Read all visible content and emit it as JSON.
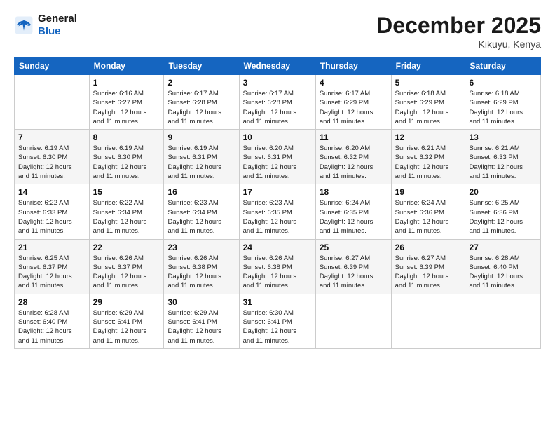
{
  "logo": {
    "line1": "General",
    "line2": "Blue"
  },
  "title": "December 2025",
  "location": "Kikuyu, Kenya",
  "header_days": [
    "Sunday",
    "Monday",
    "Tuesday",
    "Wednesday",
    "Thursday",
    "Friday",
    "Saturday"
  ],
  "weeks": [
    [
      {
        "day": "",
        "info": ""
      },
      {
        "day": "1",
        "info": "Sunrise: 6:16 AM\nSunset: 6:27 PM\nDaylight: 12 hours\nand 11 minutes."
      },
      {
        "day": "2",
        "info": "Sunrise: 6:17 AM\nSunset: 6:28 PM\nDaylight: 12 hours\nand 11 minutes."
      },
      {
        "day": "3",
        "info": "Sunrise: 6:17 AM\nSunset: 6:28 PM\nDaylight: 12 hours\nand 11 minutes."
      },
      {
        "day": "4",
        "info": "Sunrise: 6:17 AM\nSunset: 6:29 PM\nDaylight: 12 hours\nand 11 minutes."
      },
      {
        "day": "5",
        "info": "Sunrise: 6:18 AM\nSunset: 6:29 PM\nDaylight: 12 hours\nand 11 minutes."
      },
      {
        "day": "6",
        "info": "Sunrise: 6:18 AM\nSunset: 6:29 PM\nDaylight: 12 hours\nand 11 minutes."
      }
    ],
    [
      {
        "day": "7",
        "info": "Sunrise: 6:19 AM\nSunset: 6:30 PM\nDaylight: 12 hours\nand 11 minutes."
      },
      {
        "day": "8",
        "info": "Sunrise: 6:19 AM\nSunset: 6:30 PM\nDaylight: 12 hours\nand 11 minutes."
      },
      {
        "day": "9",
        "info": "Sunrise: 6:19 AM\nSunset: 6:31 PM\nDaylight: 12 hours\nand 11 minutes."
      },
      {
        "day": "10",
        "info": "Sunrise: 6:20 AM\nSunset: 6:31 PM\nDaylight: 12 hours\nand 11 minutes."
      },
      {
        "day": "11",
        "info": "Sunrise: 6:20 AM\nSunset: 6:32 PM\nDaylight: 12 hours\nand 11 minutes."
      },
      {
        "day": "12",
        "info": "Sunrise: 6:21 AM\nSunset: 6:32 PM\nDaylight: 12 hours\nand 11 minutes."
      },
      {
        "day": "13",
        "info": "Sunrise: 6:21 AM\nSunset: 6:33 PM\nDaylight: 12 hours\nand 11 minutes."
      }
    ],
    [
      {
        "day": "14",
        "info": "Sunrise: 6:22 AM\nSunset: 6:33 PM\nDaylight: 12 hours\nand 11 minutes."
      },
      {
        "day": "15",
        "info": "Sunrise: 6:22 AM\nSunset: 6:34 PM\nDaylight: 12 hours\nand 11 minutes."
      },
      {
        "day": "16",
        "info": "Sunrise: 6:23 AM\nSunset: 6:34 PM\nDaylight: 12 hours\nand 11 minutes."
      },
      {
        "day": "17",
        "info": "Sunrise: 6:23 AM\nSunset: 6:35 PM\nDaylight: 12 hours\nand 11 minutes."
      },
      {
        "day": "18",
        "info": "Sunrise: 6:24 AM\nSunset: 6:35 PM\nDaylight: 12 hours\nand 11 minutes."
      },
      {
        "day": "19",
        "info": "Sunrise: 6:24 AM\nSunset: 6:36 PM\nDaylight: 12 hours\nand 11 minutes."
      },
      {
        "day": "20",
        "info": "Sunrise: 6:25 AM\nSunset: 6:36 PM\nDaylight: 12 hours\nand 11 minutes."
      }
    ],
    [
      {
        "day": "21",
        "info": "Sunrise: 6:25 AM\nSunset: 6:37 PM\nDaylight: 12 hours\nand 11 minutes."
      },
      {
        "day": "22",
        "info": "Sunrise: 6:26 AM\nSunset: 6:37 PM\nDaylight: 12 hours\nand 11 minutes."
      },
      {
        "day": "23",
        "info": "Sunrise: 6:26 AM\nSunset: 6:38 PM\nDaylight: 12 hours\nand 11 minutes."
      },
      {
        "day": "24",
        "info": "Sunrise: 6:26 AM\nSunset: 6:38 PM\nDaylight: 12 hours\nand 11 minutes."
      },
      {
        "day": "25",
        "info": "Sunrise: 6:27 AM\nSunset: 6:39 PM\nDaylight: 12 hours\nand 11 minutes."
      },
      {
        "day": "26",
        "info": "Sunrise: 6:27 AM\nSunset: 6:39 PM\nDaylight: 12 hours\nand 11 minutes."
      },
      {
        "day": "27",
        "info": "Sunrise: 6:28 AM\nSunset: 6:40 PM\nDaylight: 12 hours\nand 11 minutes."
      }
    ],
    [
      {
        "day": "28",
        "info": "Sunrise: 6:28 AM\nSunset: 6:40 PM\nDaylight: 12 hours\nand 11 minutes."
      },
      {
        "day": "29",
        "info": "Sunrise: 6:29 AM\nSunset: 6:41 PM\nDaylight: 12 hours\nand 11 minutes."
      },
      {
        "day": "30",
        "info": "Sunrise: 6:29 AM\nSunset: 6:41 PM\nDaylight: 12 hours\nand 11 minutes."
      },
      {
        "day": "31",
        "info": "Sunrise: 6:30 AM\nSunset: 6:41 PM\nDaylight: 12 hours\nand 11 minutes."
      },
      {
        "day": "",
        "info": ""
      },
      {
        "day": "",
        "info": ""
      },
      {
        "day": "",
        "info": ""
      }
    ]
  ]
}
